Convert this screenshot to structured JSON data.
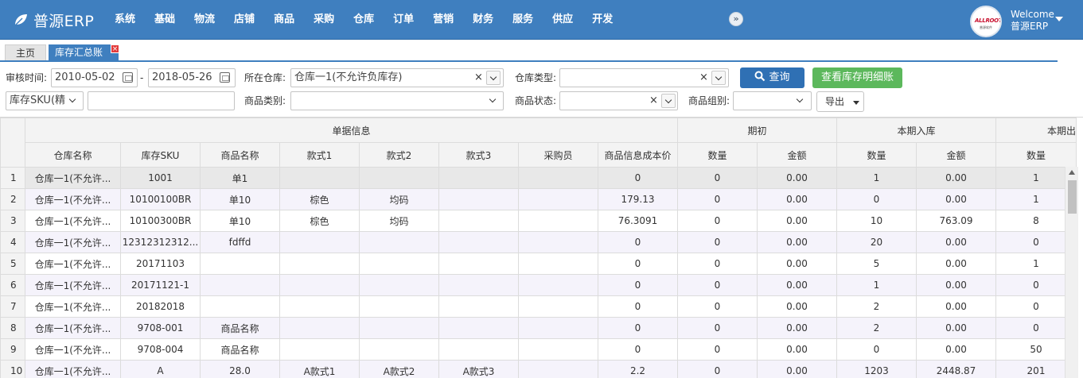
{
  "app": {
    "name": "普源ERP"
  },
  "nav": [
    "系统",
    "基础",
    "物流",
    "店铺",
    "商品",
    "采购",
    "仓库",
    "订单",
    "营销",
    "财务",
    "服务",
    "供应",
    "开发"
  ],
  "header": {
    "expand_glyph": "»",
    "welcome": "Welcome",
    "user": "普源ERP",
    "avatar_text": "ALLROOT",
    "avatar_sub": "普源软件"
  },
  "tabs": {
    "home": "主页",
    "active": "库存汇总账",
    "close": "×"
  },
  "filters": {
    "audit_time_label": "审核时间:",
    "date_from": "2010-05-02",
    "date_sep": "-",
    "date_to": "2018-05-26",
    "warehouse_label": "所在仓库:",
    "warehouse_value": "仓库一1(不允许负库存)",
    "clear_glyph": "×",
    "warehouse_type_label": "仓库类型:",
    "warehouse_type_value": "",
    "query_button": "查询",
    "detail_button": "查看库存明细账",
    "sku_mode": "库存SKU(精",
    "sku_input": "",
    "category_label": "商品类别:",
    "category_value": "",
    "status_label": "商品状态:",
    "status_value": "",
    "group_label": "商品组别:",
    "group_value": "",
    "export_button": "导出"
  },
  "grid": {
    "group_headers": {
      "info": "单据信息",
      "opening": "期初",
      "inbound": "本期入库",
      "outbound": "本期出"
    },
    "columns": [
      "仓库名称",
      "库存SKU",
      "商品名称",
      "款式1",
      "款式2",
      "款式3",
      "采购员",
      "商品信息成本价",
      "数量",
      "金额",
      "数量",
      "金额",
      "数量"
    ],
    "rows": [
      [
        "1",
        "仓库一1(不允许...",
        "1001",
        "单1",
        "",
        "",
        "",
        "",
        "0",
        "0",
        "0.00",
        "1",
        "0.00",
        "1"
      ],
      [
        "2",
        "仓库一1(不允许...",
        "10100100BR",
        "单10",
        "棕色",
        "均码",
        "",
        "",
        "179.13",
        "0",
        "0.00",
        "0",
        "0.00",
        "1"
      ],
      [
        "3",
        "仓库一1(不允许...",
        "10100300BR",
        "单10",
        "棕色",
        "均码",
        "",
        "",
        "76.3091",
        "0",
        "0.00",
        "10",
        "763.09",
        "8"
      ],
      [
        "4",
        "仓库一1(不允许...",
        "12312312312...",
        "fdffd",
        "",
        "",
        "",
        "",
        "0",
        "0",
        "0.00",
        "20",
        "0.00",
        "0"
      ],
      [
        "5",
        "仓库一1(不允许...",
        "20171103",
        "",
        "",
        "",
        "",
        "",
        "0",
        "0",
        "0.00",
        "5",
        "0.00",
        "1"
      ],
      [
        "6",
        "仓库一1(不允许...",
        "20171121-1",
        "",
        "",
        "",
        "",
        "",
        "0",
        "0",
        "0.00",
        "1",
        "0.00",
        "0"
      ],
      [
        "7",
        "仓库一1(不允许...",
        "20182018",
        "",
        "",
        "",
        "",
        "",
        "0",
        "0",
        "0.00",
        "2",
        "0.00",
        "0"
      ],
      [
        "8",
        "仓库一1(不允许...",
        "9708-001",
        "商品名称",
        "",
        "",
        "",
        "",
        "0",
        "0",
        "0.00",
        "2",
        "0.00",
        "0"
      ],
      [
        "9",
        "仓库一1(不允许...",
        "9708-004",
        "商品名称",
        "",
        "",
        "",
        "",
        "0",
        "0",
        "0.00",
        "0",
        "0.00",
        "50"
      ],
      [
        "10",
        "仓库一1(不允许...",
        "A",
        "28.0",
        "A款式1",
        "A款式2",
        "A款式3",
        "",
        "2.2",
        "0",
        "0.00",
        "1203",
        "2448.87",
        "201"
      ]
    ]
  },
  "colors": {
    "topbar": "#3f7fbf",
    "query_button": "#2f70b4",
    "detail_button": "#5cb85c",
    "alt_row": "#f5f3fb",
    "selected_row": "#e8e8e8"
  }
}
